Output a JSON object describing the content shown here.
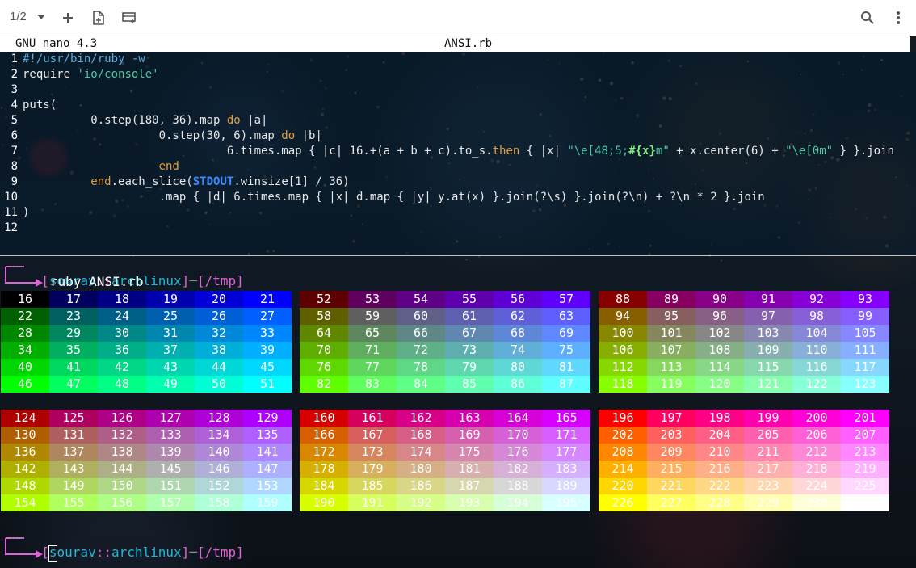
{
  "toolbar": {
    "tab_counter": "1/2",
    "icons": [
      "tab-dropdown-icon",
      "new-tab-icon",
      "new-window-icon",
      "layout-icon",
      "search-icon",
      "more-vert-icon"
    ]
  },
  "nano": {
    "version": "GNU nano 4.3",
    "filename": "ANSI.rb",
    "lines": [
      {
        "n": "1",
        "segs": [
          {
            "t": "#!/usr/bin/ruby -w",
            "c": "#5ab0e0"
          }
        ]
      },
      {
        "n": "2",
        "segs": [
          {
            "t": "require ",
            "c": "#e8e8e8"
          },
          {
            "t": "'io/console'",
            "c": "#4ec9a8"
          }
        ]
      },
      {
        "n": "3",
        "segs": []
      },
      {
        "n": "4",
        "segs": [
          {
            "t": "puts(",
            "c": "#e8e8e8"
          }
        ]
      },
      {
        "n": "5",
        "segs": [
          {
            "t": "          0.step(180, 36).map ",
            "c": "#e8e8e8"
          },
          {
            "t": "do",
            "c": "#e0a040"
          },
          {
            "t": " |a|",
            "c": "#e8e8e8"
          }
        ]
      },
      {
        "n": "6",
        "segs": [
          {
            "t": "                    0.step(30, 6).map ",
            "c": "#e8e8e8"
          },
          {
            "t": "do",
            "c": "#e0a040"
          },
          {
            "t": " |b|",
            "c": "#e8e8e8"
          }
        ]
      },
      {
        "n": "7",
        "segs": [
          {
            "t": "                              6.times.map { |c| 16.+(a + b + c).to_s.",
            "c": "#e8e8e8"
          },
          {
            "t": "then",
            "c": "#e0a040"
          },
          {
            "t": " { |x| ",
            "c": "#e8e8e8"
          },
          {
            "t": "\"\\e[48;5;",
            "c": "#4ec9a8"
          },
          {
            "t": "#{x}",
            "c": "#7df07d",
            "b": true
          },
          {
            "t": "m\"",
            "c": "#4ec9a8"
          },
          {
            "t": " + x.center(6) + ",
            "c": "#e8e8e8"
          },
          {
            "t": "\"\\e[0m\"",
            "c": "#4ec9a8"
          },
          {
            "t": " } }.join",
            "c": "#e8e8e8"
          }
        ]
      },
      {
        "n": "8",
        "segs": [
          {
            "t": "                    ",
            "c": "#e8e8e8"
          },
          {
            "t": "end",
            "c": "#e0a040"
          }
        ]
      },
      {
        "n": "9",
        "segs": [
          {
            "t": "          ",
            "c": "#e8e8e8"
          },
          {
            "t": "end",
            "c": "#e0a040"
          },
          {
            "t": ".each_slice(",
            "c": "#e8e8e8"
          },
          {
            "t": "STDOUT",
            "c": "#3a8cff",
            "b": true
          },
          {
            "t": ".winsize[1] / 36)",
            "c": "#e8e8e8"
          }
        ]
      },
      {
        "n": "10",
        "segs": [
          {
            "t": "                    .map { |d| 6.times.map { |x| d.map { |y| y.at(x) }.join(?\\s) }.join(?\\n) + ?\\n * 2 }.join",
            "c": "#e8e8e8"
          }
        ]
      },
      {
        "n": "11",
        "segs": [
          {
            "t": ")",
            "c": "#e8e8e8"
          }
        ]
      },
      {
        "n": "12",
        "segs": []
      }
    ]
  },
  "terminal": {
    "prompt1": {
      "user": "sourav",
      "sep": "::",
      "host": "archlinux",
      "path": "/tmp"
    },
    "command": "ruby ANSI.rb",
    "prompt2": {
      "user": "sourav",
      "sep": "::",
      "host": "archlinux",
      "path": "/tmp"
    }
  }
}
